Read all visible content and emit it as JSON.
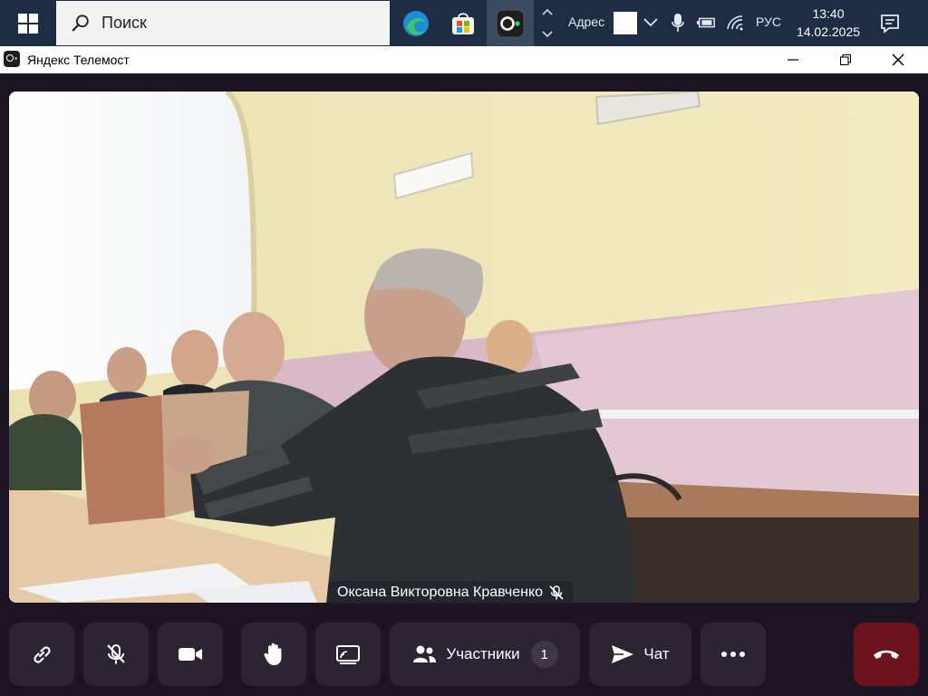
{
  "taskbar": {
    "search_placeholder": "Поиск",
    "address_label": "Адрес",
    "language": "РУС",
    "time": "13:40",
    "date": "14.02.2025"
  },
  "window": {
    "title": "Яндекс Телемост"
  },
  "meeting": {
    "participant_name": "Оксана Викторовна Кравченко",
    "participant_muted": true
  },
  "controls": {
    "participants_label": "Участники",
    "participants_count": "1",
    "chat_label": "Чат"
  },
  "colors": {
    "taskbar_bg": "#1f2d44",
    "stage_bg": "#1c1422",
    "control_bg": "#2c2433",
    "end_call_bg": "#6b1420",
    "accent_green": "#37d96a"
  },
  "icons": [
    "windows-start-icon",
    "search-icon",
    "edge-icon",
    "store-icon",
    "telemost-icon",
    "chevron-up-icon",
    "chevron-down-icon",
    "microphone-icon",
    "battery-icon",
    "wifi-icon",
    "notification-icon",
    "minimize-icon",
    "restore-icon",
    "close-icon",
    "link-icon",
    "mic-off-icon",
    "camera-icon",
    "hand-icon",
    "screen-share-icon",
    "participants-icon",
    "send-icon",
    "more-icon",
    "hangup-icon"
  ]
}
